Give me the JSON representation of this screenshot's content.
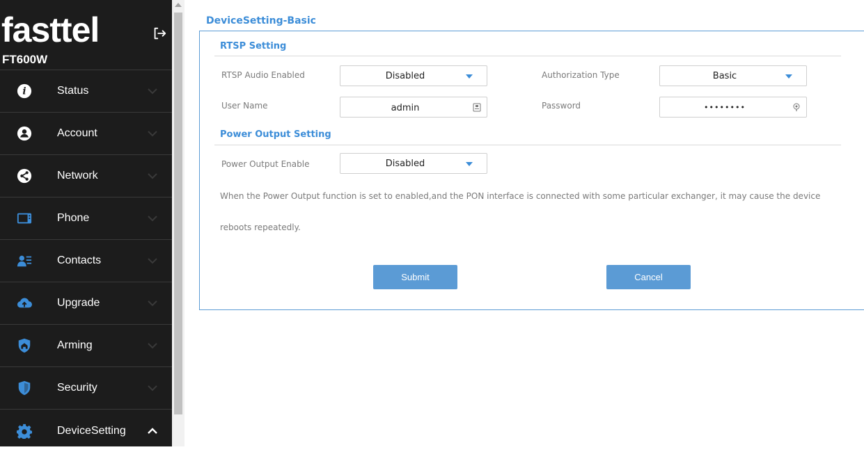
{
  "sidebar": {
    "brand": "fasttel",
    "model": "FT600W",
    "items": [
      {
        "label": "Status",
        "icon": "info-icon"
      },
      {
        "label": "Account",
        "icon": "user-icon"
      },
      {
        "label": "Network",
        "icon": "network-icon"
      },
      {
        "label": "Phone",
        "icon": "phone-icon"
      },
      {
        "label": "Contacts",
        "icon": "contacts-icon"
      },
      {
        "label": "Upgrade",
        "icon": "cloud-upload-icon"
      },
      {
        "label": "Arming",
        "icon": "home-shield-icon"
      },
      {
        "label": "Security",
        "icon": "shield-icon"
      },
      {
        "label": "DeviceSetting",
        "icon": "gear-icon",
        "expanded": true
      }
    ]
  },
  "main": {
    "page_title": "DeviceSetting-Basic",
    "rtsp": {
      "title": "RTSP Setting",
      "audio_label": "RTSP Audio Enabled",
      "audio_value": "Disabled",
      "auth_label": "Authorization Type",
      "auth_value": "Basic",
      "user_label": "User Name",
      "user_value": "admin",
      "password_label": "Password",
      "password_value": "••••••••"
    },
    "power": {
      "title": "Power Output Setting",
      "enable_label": "Power Output Enable",
      "enable_value": "Disabled",
      "note_line1": "When the Power Output function is set to enabled,and the PON interface is connected with some particular exchanger, it may cause the device",
      "note_line2": "reboots repeatedly."
    },
    "buttons": {
      "submit": "Submit",
      "cancel": "Cancel"
    }
  },
  "colors": {
    "accent": "#3c8dd8",
    "button": "#5b9bd5",
    "sidebar_bg": "#1c1c1c"
  }
}
